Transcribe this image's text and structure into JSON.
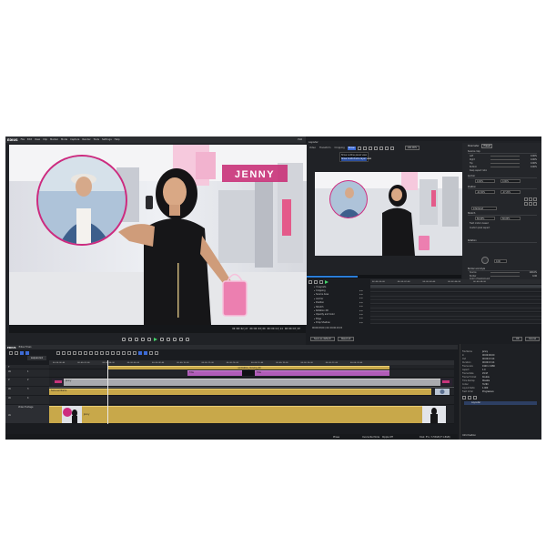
{
  "app": {
    "logo": "EDIUS",
    "menu": [
      "File",
      "Edit",
      "View",
      "Clip",
      "Marker",
      "Mode",
      "Capture",
      "Render",
      "Tools",
      "Settings",
      "Help"
    ],
    "window_mode": "PLR"
  },
  "main_preview": {
    "name_tag": "JENNY",
    "timecodes": [
      "00:00:02;27",
      "00:00:03;00",
      "00:00:13;14",
      "00:00:07;07"
    ]
  },
  "right_panel": {
    "title": "Layouter",
    "tabs": [
      "Video",
      "Transform",
      "Cropping",
      "Show"
    ],
    "active_tab": "Show",
    "zoom": "100.00%",
    "dropdown_items": [
      "Show outline panel view",
      "Show multi-frame layer view"
    ],
    "dropdown_selected": 1,
    "inspector_tabs": [
      "Parameter",
      "Preset"
    ],
    "inspector_active": "Preset",
    "sections": {
      "crop": "Source crop",
      "anchor": "Anchor",
      "position": "Position",
      "stretch": "Stretch",
      "rotation": "Rotation",
      "border": "Border and style"
    },
    "crop_rows": [
      {
        "label": "Left",
        "value": "0.00%"
      },
      {
        "label": "Right",
        "value": "0.00%"
      },
      {
        "label": "Top",
        "value": "0.00%"
      },
      {
        "label": "Bottom",
        "value": "0.00%"
      }
    ],
    "keep_aspect": "Keep aspect ratio",
    "anchor_values": [
      "0.00%",
      "0.00%"
    ],
    "position_values": [
      "-22.00%",
      "-27.20%"
    ],
    "stretch_values": [
      "60.00%",
      "60.00%"
    ],
    "transform_label": "Interlaced",
    "interlace_method": "Field motion based",
    "custom_pixel": "Custom pixel aspect",
    "border_rows": [
      {
        "label": "Source",
        "value": "100.0%"
      },
      {
        "label": "Border",
        "value": "0.00"
      },
      {
        "label": "Color of background",
        "value": ""
      }
    ],
    "rotation_value": "0.00",
    "track_timecodes": [
      "00:00:00;00",
      "00:00:02;00",
      "00:00:04;00",
      "00:00:06;00",
      "00:00:08;00"
    ],
    "track_items": [
      {
        "label": "3 Layouts"
      },
      {
        "label": "Cropping"
      },
      {
        "label": "Source Area"
      },
      {
        "label": "Anchor"
      },
      {
        "label": "Position"
      },
      {
        "label": "Stretch"
      },
      {
        "label": "Rotation 2D"
      },
      {
        "label": "Opacity and Color"
      },
      {
        "label": "Edge"
      },
      {
        "label": "Drop Shadow"
      }
    ],
    "track_time": "00:00:03;00 / 0d: 00:00:13;15",
    "buttons": {
      "save_default": "Save as default",
      "reset_all": "Reset all",
      "ok": "OK",
      "cancel": "Cancel"
    }
  },
  "timeline": {
    "logo": "EDIUS",
    "title": "Edius Tmeo",
    "sequence_tab": "sequence1",
    "ruler": [
      "00:00:00;00",
      "00:00:02;00",
      "00:00:04;00",
      "00:00:06;00",
      "00:00:08;00",
      "00:00:10;00",
      "00:00:12;00",
      "00:00:14;00",
      "00:00:16;00",
      "00:00:18;00",
      "00:00:20;00",
      "00:00:22;00",
      "00:00:24;00"
    ],
    "tracks": [
      {
        "label": "T",
        "label2": ""
      },
      {
        "label": "VA",
        "label2": "1"
      },
      {
        "label": "V",
        "label2": "2"
      },
      {
        "label": "VA",
        "label2": "3"
      },
      {
        "label": "VA",
        "label2": "4"
      },
      {
        "label": "Video Footage",
        "label2": "VA"
      }
    ],
    "clips": {
      "t_clip": "animation_moving_00",
      "purple_a": "Title",
      "purple_b": "Title",
      "grey": "Jenny",
      "gold": "Sans ser Name",
      "footage": "Jenny"
    },
    "status": {
      "mode": "Phase",
      "overwrite": "Overwrite Mode",
      "ripple": "Ripple Off",
      "disk": "Disk: 5% / 3.55GB (F:1.8GB)"
    }
  },
  "info_panel": {
    "title": "Information",
    "rows": [
      {
        "k": "File Name",
        "v": "Jenny"
      },
      {
        "k": "In",
        "v": "00:00:00;00"
      },
      {
        "k": "Out",
        "v": "00:00:13;14"
      },
      {
        "k": "Duration",
        "v": "00:00:13;14"
      },
      {
        "k": "Frame size",
        "v": "1920 x 1080"
      },
      {
        "k": "Aspect",
        "v": "1.0"
      },
      {
        "k": "Frame Rate",
        "v": "29.97"
      },
      {
        "k": "Frame Format",
        "v": "Double"
      },
      {
        "k": "Time Remap",
        "v": "Disable"
      },
      {
        "k": "Codec",
        "v": "H.264"
      },
      {
        "k": "Layout Ratio",
        "v": "1.000"
      },
      {
        "k": "Field Order",
        "v": "Progressive"
      }
    ],
    "filter_label": "Layouter"
  },
  "colors": {
    "accent_blue": "#3d6bd6",
    "clip_gold": "#c8a84a",
    "clip_purple": "#b05cb8",
    "name_tag_bg": "#c9357b",
    "play_green": "#44d36a"
  }
}
